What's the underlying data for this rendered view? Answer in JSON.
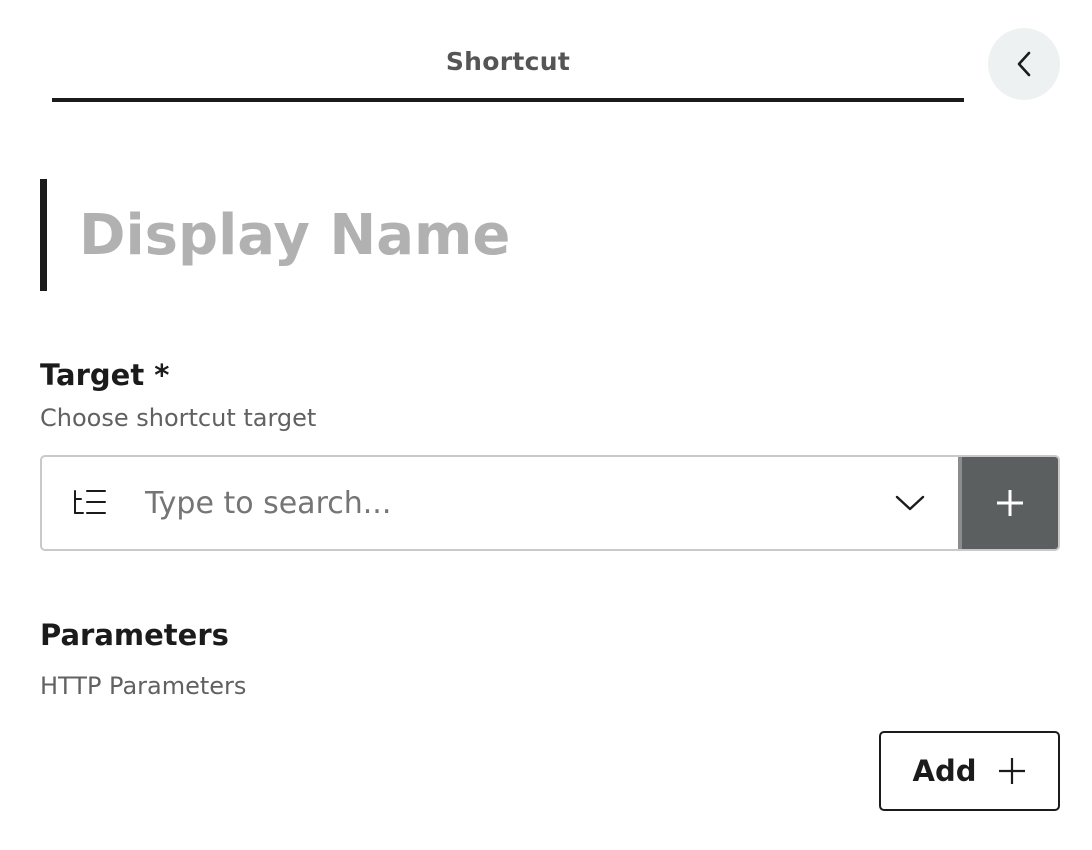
{
  "header": {
    "tab_label": "Shortcut",
    "back_icon": "chevron-left-icon"
  },
  "display_name": {
    "value": "",
    "placeholder": "Display Name"
  },
  "target": {
    "title": "Target *",
    "description": "Choose shortcut target",
    "search_placeholder": "Type to search...",
    "search_value": "",
    "leading_icon": "tree-list-icon",
    "dropdown_icon": "chevron-down-icon",
    "add_icon": "plus-icon"
  },
  "parameters": {
    "title": "Parameters",
    "description": "HTTP Parameters",
    "add_label": "Add",
    "add_icon": "plus-icon"
  },
  "colors": {
    "text": "#1b1b1b",
    "muted": "#616161",
    "placeholder_large": "#b1b1b1",
    "add_target_bg": "#5b5f60",
    "back_bg": "#eef1f2"
  }
}
